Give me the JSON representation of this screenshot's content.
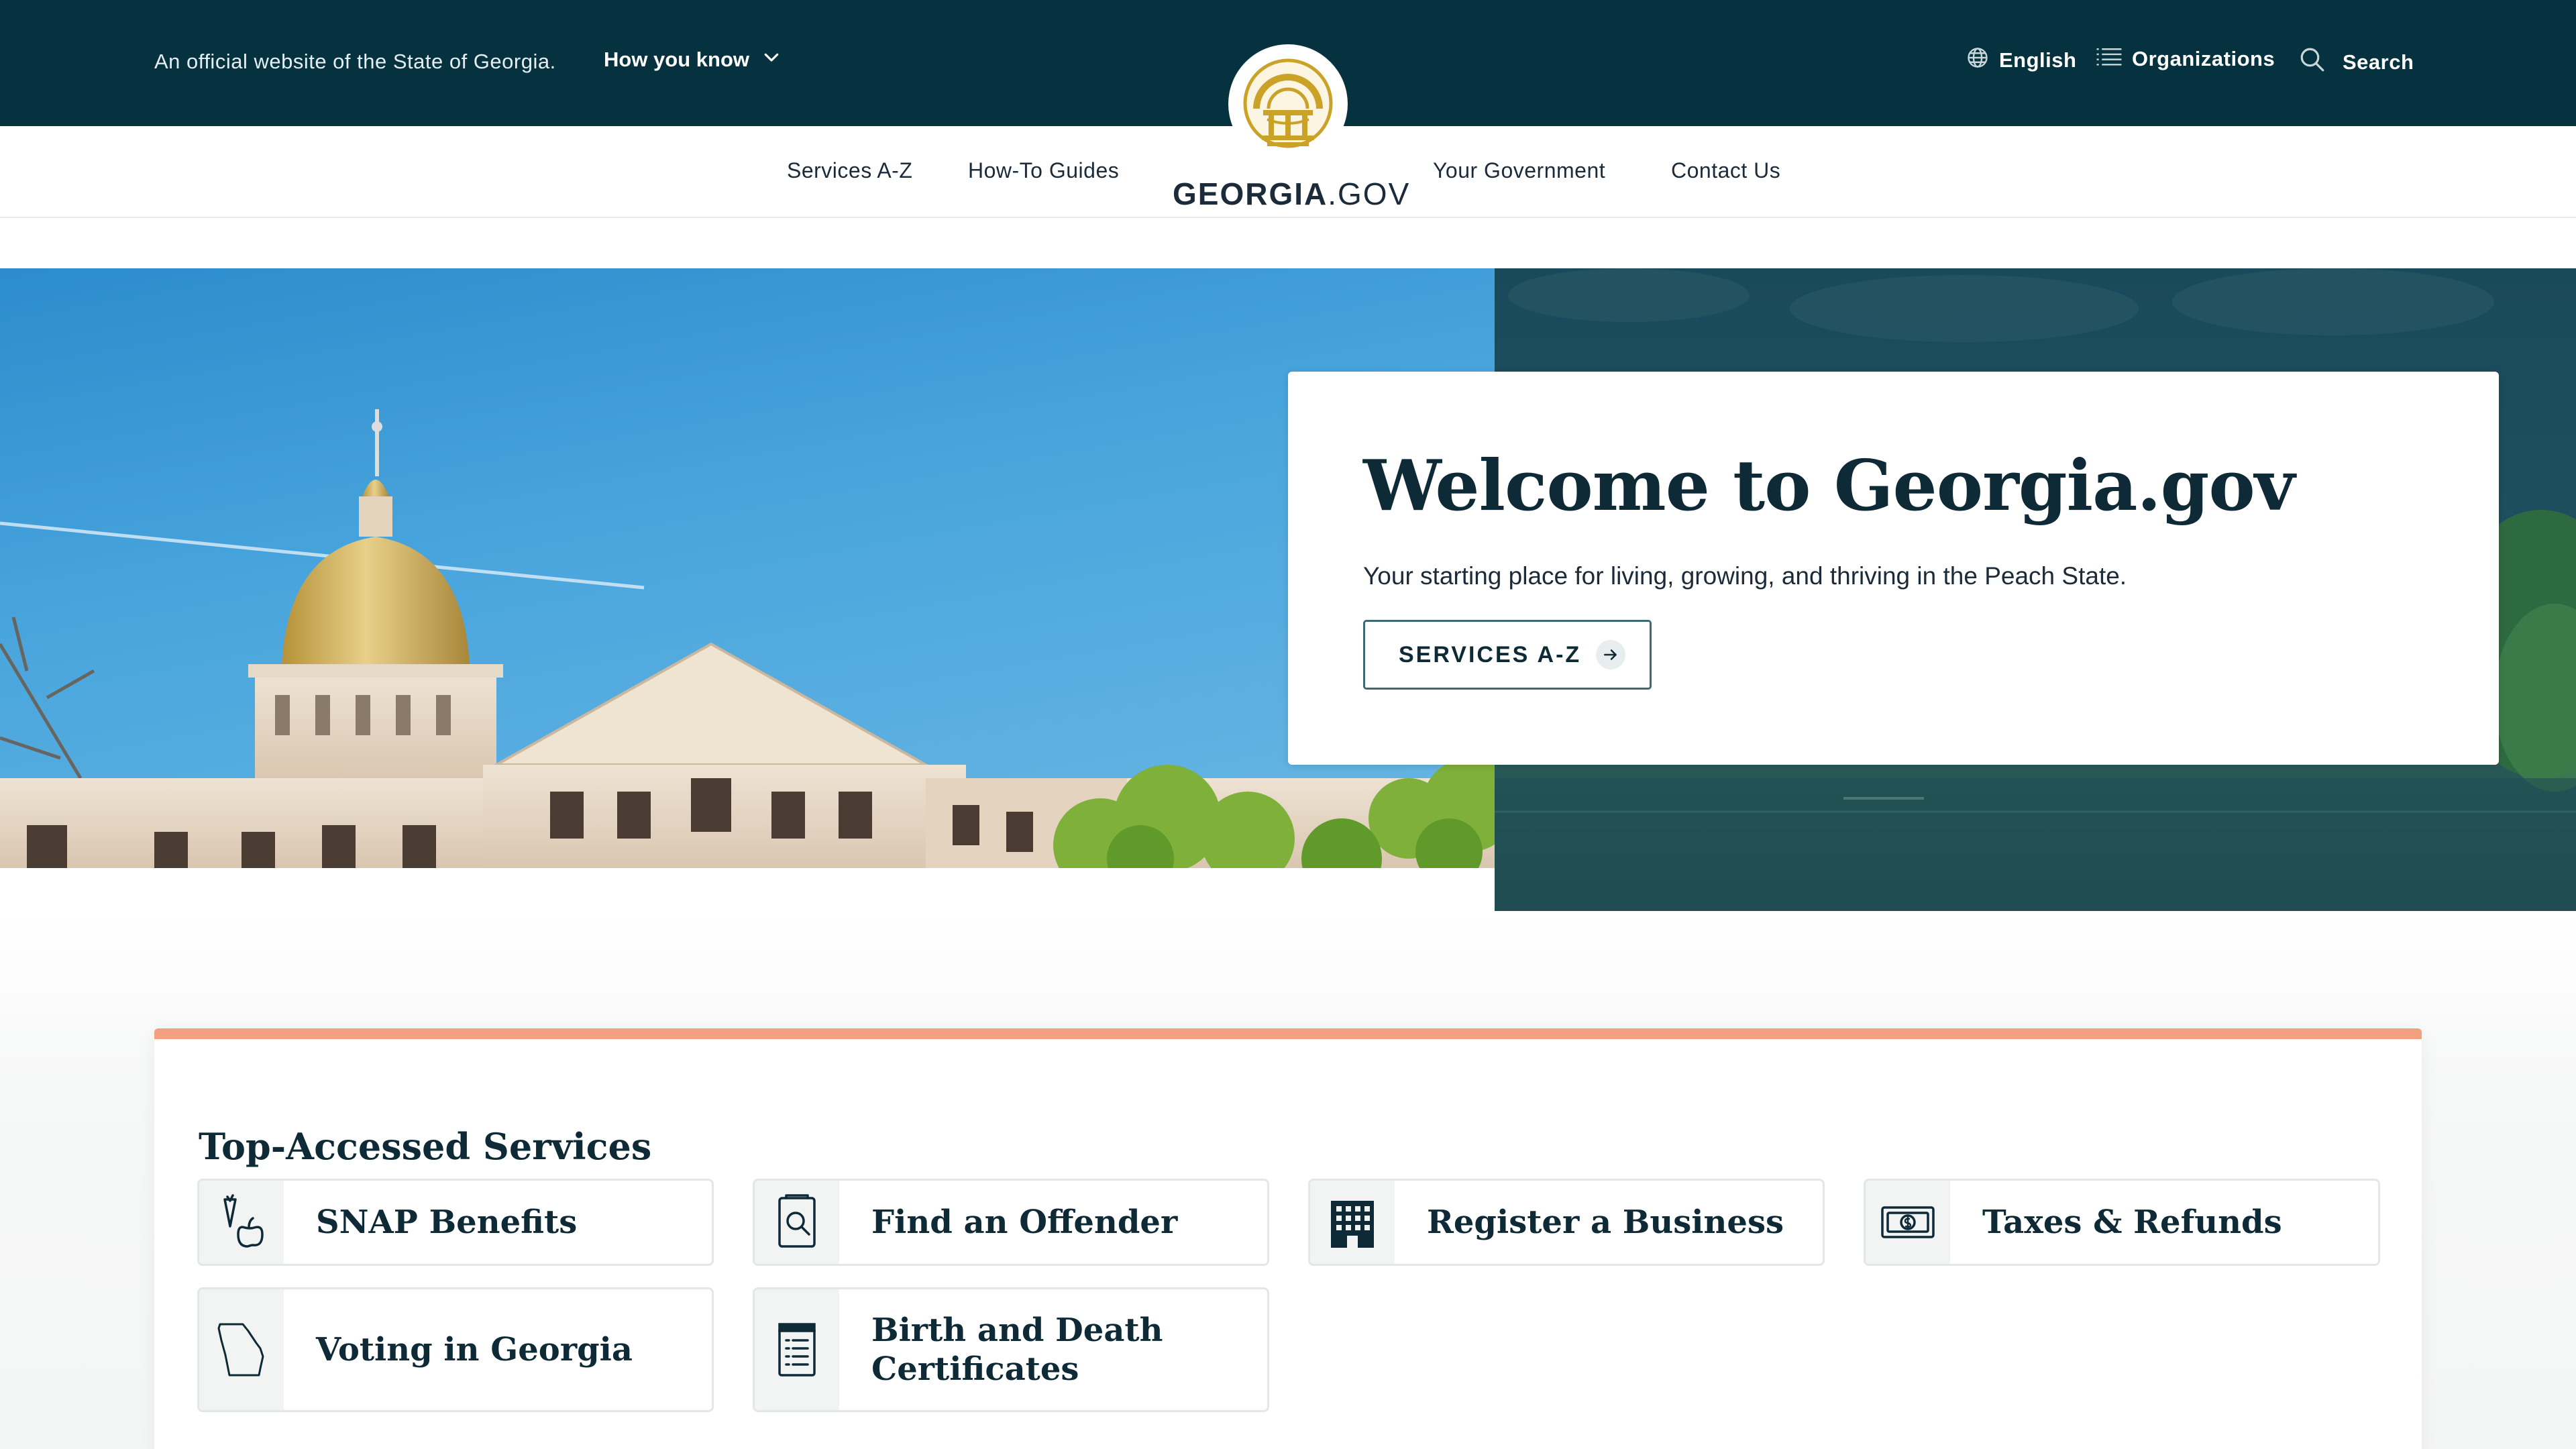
{
  "banner": {
    "official_text": "An official website of the State of Georgia.",
    "how_you_know": "How you know",
    "language": "English",
    "organizations": "Organizations",
    "search": "Search"
  },
  "logo": {
    "bold": "GEORGIA",
    "light": ".GOV"
  },
  "nav": {
    "services_az": "Services A-Z",
    "how_to_guides": "How-To Guides",
    "your_government": "Your Government",
    "contact_us": "Contact Us"
  },
  "hero": {
    "title": "Welcome to Georgia.gov",
    "subtitle": "Your starting place for living, growing, and thriving in the Peach State.",
    "button": "SERVICES A-Z"
  },
  "services": {
    "title": "Top-Accessed Services",
    "items": [
      {
        "label": "SNAP Benefits",
        "icon": "snap-carrot-apple-icon"
      },
      {
        "label": "Find an Offender",
        "icon": "document-search-icon"
      },
      {
        "label": "Register a Business",
        "icon": "building-icon"
      },
      {
        "label": "Taxes & Refunds",
        "icon": "money-bill-icon"
      },
      {
        "label": "Voting in Georgia",
        "icon": "georgia-state-outline-icon"
      },
      {
        "label": "Birth and Death Certificates",
        "icon": "certificate-document-icon"
      }
    ]
  },
  "colors": {
    "banner_bg": "#06323f",
    "accent_stripe": "#f2a07f",
    "seal_gold": "#c9a227",
    "heading": "#0e2a36"
  }
}
